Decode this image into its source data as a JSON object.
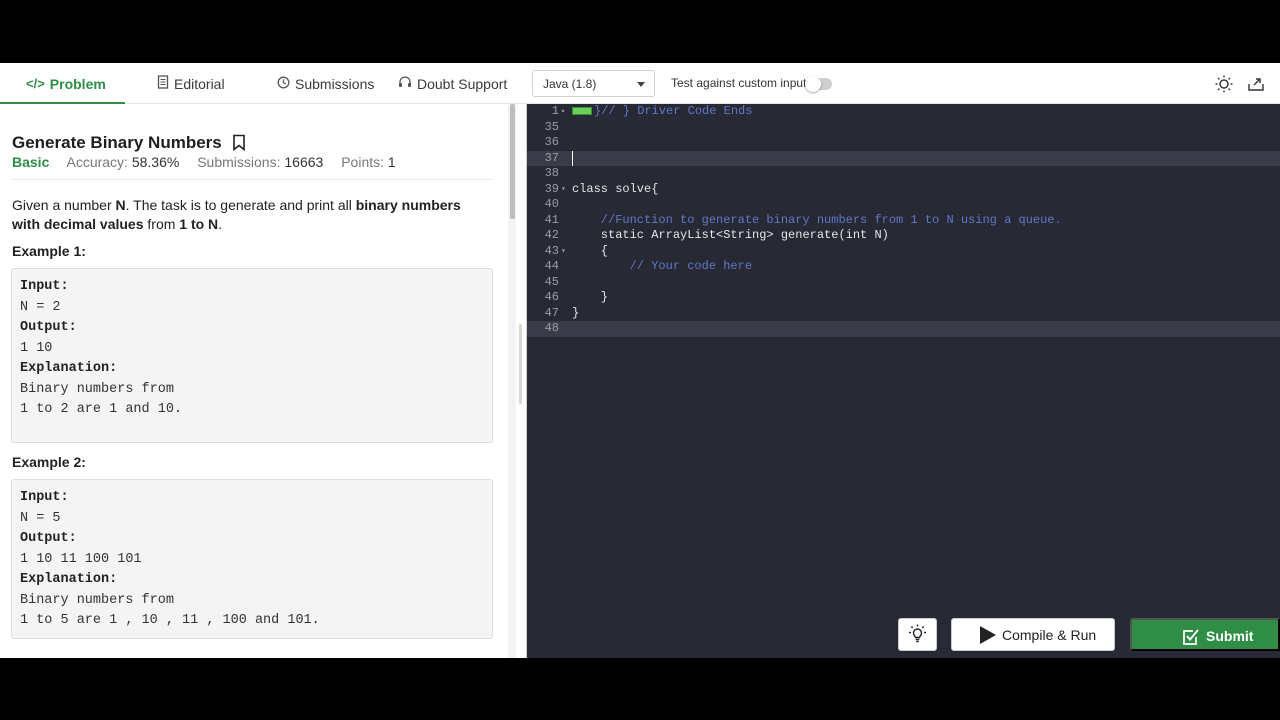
{
  "tabs": [
    {
      "label": "Problem",
      "icon": "code-icon",
      "active": true
    },
    {
      "label": "Editorial",
      "icon": "document-icon"
    },
    {
      "label": "Submissions",
      "icon": "clock-icon"
    },
    {
      "label": "Doubt Support",
      "icon": "headset-icon"
    }
  ],
  "toolbar": {
    "language": "Java (1.8)",
    "custom_input_label": "Test against custom input"
  },
  "problem": {
    "title": "Generate Binary Numbers",
    "difficulty": "Basic",
    "accuracy_label": "Accuracy:",
    "accuracy": "58.36%",
    "submissions_label": "Submissions:",
    "submissions": "16663",
    "points_label": "Points:",
    "points": "1",
    "desc": {
      "p1": "Given a number ",
      "b1": "N",
      "p2": ". The task is to generate and print all ",
      "b2": "binary numbers with decimal values",
      "p3": " from ",
      "b3": "1 to N",
      "p4": "."
    },
    "examples": [
      {
        "title": "Example 1:",
        "input_label": "Input:",
        "input": "N = 2",
        "output_label": "Output:",
        "output": "1 10",
        "explanation_label": "Explanation:",
        "explanation_1": "Binary numbers from",
        "explanation_2": "1 to 2 are 1 and 10."
      },
      {
        "title": "Example 2:",
        "input_label": "Input:",
        "input": "N = 5",
        "output_label": "Output:",
        "output": "1 10 11 100 101",
        "explanation_label": "Explanation:",
        "explanation_1": "Binary numbers from",
        "explanation_2": "1 to 5 are 1 , 10 , 11 , 100 and 101."
      }
    ]
  },
  "editor": {
    "lines": [
      {
        "n": "1",
        "fold": "▸",
        "marker": true,
        "text": "}// } Driver Code Ends",
        "cls": "c-comment"
      },
      {
        "n": "35",
        "text": ""
      },
      {
        "n": "36",
        "text": ""
      },
      {
        "n": "37",
        "text": "",
        "highlight": true
      },
      {
        "n": "38",
        "text": ""
      },
      {
        "n": "39",
        "fold": "▾",
        "text": "class solve{"
      },
      {
        "n": "40",
        "text": ""
      },
      {
        "n": "41",
        "text": "    //Function to generate binary numbers from 1 to N using a queue.",
        "cls": "c-comment"
      },
      {
        "n": "42",
        "text": "    static ArrayList<String> generate(int N)"
      },
      {
        "n": "43",
        "fold": "▾",
        "text": "    {"
      },
      {
        "n": "44",
        "text": "        // Your code here",
        "cls": "c-comment"
      },
      {
        "n": "45",
        "text": ""
      },
      {
        "n": "46",
        "text": "    }"
      },
      {
        "n": "47",
        "text": "}"
      },
      {
        "n": "48",
        "text": "",
        "highlight": true
      }
    ]
  },
  "actions": {
    "compile_label": "Compile & Run",
    "submit_label": "Submit"
  },
  "colors": {
    "brand": "#2f8d46",
    "editor_bg": "#272935",
    "comment": "#6277c7"
  }
}
